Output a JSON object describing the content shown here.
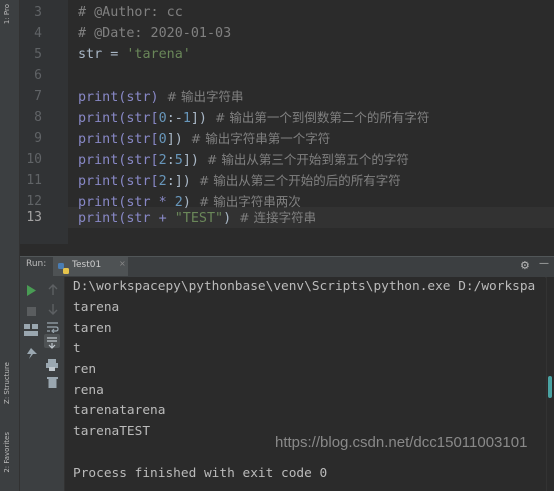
{
  "left_strip": {
    "project_tab": "1: Pro",
    "structure_tab": "Z: Structure",
    "favorites_tab": "2: Favorites"
  },
  "editor": {
    "line_numbers": [
      "3",
      "4",
      "5",
      "6",
      "7",
      "8",
      "9",
      "10",
      "11",
      "12",
      "13"
    ],
    "current_line": "13",
    "lines": {
      "l3": "# @Author: cc",
      "l4": "# @Date: 2020-01-03",
      "l5_var": "str = ",
      "l5_str": "'tarena'",
      "l7_code": "print(str)",
      "l7_cmt": "  # 输出字符串",
      "l8_code_a": "print(str[",
      "l8_num_a": "0",
      "l8_code_b": ":-",
      "l8_num_b": "1",
      "l8_code_c": "])",
      "l8_cmt": "  # 输出第一个到倒数第二个的所有字符",
      "l9_code_a": "print(str[",
      "l9_num": "0",
      "l9_code_b": "])",
      "l9_cmt": "  # 输出字符串第一个字符",
      "l10_code_a": "print(str[",
      "l10_num_a": "2",
      "l10_code_b": ":",
      "l10_num_b": "5",
      "l10_code_c": "])",
      "l10_cmt": "  # 输出从第三个开始到第五个的字符",
      "l11_code_a": "print(str[",
      "l11_num": "2",
      "l11_code_b": ":])",
      "l11_cmt": "  # 输出从第三个开始的后的所有字符",
      "l12_code": "print(str * ",
      "l12_num": "2",
      "l12_close": ")",
      "l12_cmt": "  # 输出字符串两次",
      "l13_code": "print(str + ",
      "l13_str": "\"TEST\"",
      "l13_close": ")",
      "l13_cmt": "  # 连接字符串"
    }
  },
  "run_window": {
    "label": "Run:",
    "tab_name": "Test01",
    "tab_close": "×",
    "settings_icon": "⚙",
    "minimize_icon": "—"
  },
  "console": {
    "lines": [
      "D:\\workspacepy\\pythonbase\\venv\\Scripts\\python.exe D:/workspa",
      "tarena",
      "taren",
      "t",
      "ren",
      "rena",
      "tarenatarena",
      "tarenaTEST",
      "",
      "Process finished with exit code 0"
    ]
  },
  "watermark": "https://blog.csdn.net/dcc15011003101",
  "colors": {
    "background": "#2b2b2b",
    "comment": "#808080",
    "string": "#6a8759",
    "number": "#6897bb",
    "builtin": "#8888c6",
    "run_green": "#499c54"
  }
}
